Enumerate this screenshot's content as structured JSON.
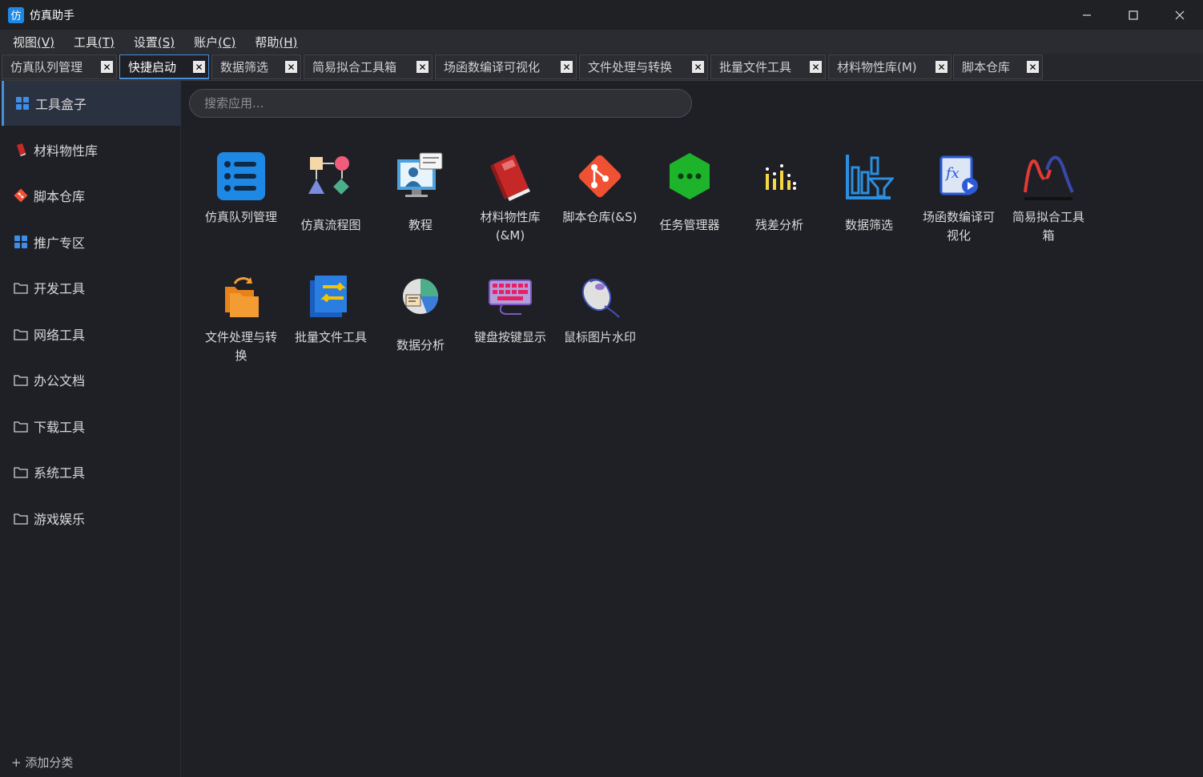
{
  "window": {
    "logo_char": "仿",
    "title": "仿真助手",
    "minimize": "─",
    "maximize": "☐",
    "close": "✕"
  },
  "menu": [
    {
      "label": "视图",
      "accel": "(V)"
    },
    {
      "label": "工具",
      "accel": "(T)"
    },
    {
      "label": "设置",
      "accel": "(S)"
    },
    {
      "label": "账户",
      "accel": "(C)"
    },
    {
      "label": "帮助",
      "accel": "(H)"
    }
  ],
  "tabs": [
    {
      "label": "仿真队列管理",
      "close": "✕",
      "active": false
    },
    {
      "label": "快捷启动",
      "close": "✕",
      "active": true
    },
    {
      "label": "数据筛选",
      "close": "✕",
      "active": false
    },
    {
      "label": "简易拟合工具箱",
      "close": "✕",
      "active": false
    },
    {
      "label": "场函数编译可视化",
      "close": "✕",
      "active": false
    },
    {
      "label": "文件处理与转换",
      "close": "✕",
      "active": false
    },
    {
      "label": "批量文件工具",
      "close": "✕",
      "active": false
    },
    {
      "label": "材料物性库(M)",
      "close": "✕",
      "active": false
    },
    {
      "label": "脚本仓库",
      "close": "✕",
      "active": false
    }
  ],
  "sidebar": {
    "items": [
      {
        "label": "工具盒子",
        "icon": "grid-icon",
        "active": true
      },
      {
        "label": "材料物性库",
        "icon": "book-icon",
        "active": false
      },
      {
        "label": "脚本仓库",
        "icon": "git-icon",
        "active": false
      },
      {
        "label": "推广专区",
        "icon": "grid-icon",
        "active": false
      },
      {
        "label": "开发工具",
        "icon": "folder-icon",
        "active": false
      },
      {
        "label": "网络工具",
        "icon": "folder-icon",
        "active": false
      },
      {
        "label": "办公文档",
        "icon": "folder-icon",
        "active": false
      },
      {
        "label": "下载工具",
        "icon": "folder-icon",
        "active": false
      },
      {
        "label": "系统工具",
        "icon": "folder-icon",
        "active": false
      },
      {
        "label": "游戏娱乐",
        "icon": "folder-icon",
        "active": false
      }
    ],
    "add_category": "+ 添加分类"
  },
  "search": {
    "placeholder": "搜索应用..."
  },
  "apps": [
    {
      "label": "仿真队列管理",
      "icon": "list-icon"
    },
    {
      "label": "仿真流程图",
      "icon": "flowchart-icon"
    },
    {
      "label": "教程",
      "icon": "tutorial-icon"
    },
    {
      "label": "材料物性库(&M)",
      "icon": "book-icon"
    },
    {
      "label": "脚本仓库(&S)",
      "icon": "git-icon"
    },
    {
      "label": "任务管理器",
      "icon": "task-manager-icon"
    },
    {
      "label": "残差分析",
      "icon": "residual-chart-icon"
    },
    {
      "label": "数据筛选",
      "icon": "data-filter-icon"
    },
    {
      "label": "场函数编译可视化",
      "icon": "field-function-icon"
    },
    {
      "label": "简易拟合工具箱",
      "icon": "curve-fit-icon"
    },
    {
      "label": "文件处理与转换",
      "icon": "file-convert-icon"
    },
    {
      "label": "批量文件工具",
      "icon": "batch-file-icon"
    },
    {
      "label": "数据分析",
      "icon": "data-analysis-icon"
    },
    {
      "label": "键盘按键显示",
      "icon": "keyboard-icon"
    },
    {
      "label": "鼠标图片水印",
      "icon": "mouse-icon"
    }
  ],
  "colors": {
    "background": "#1f2026",
    "accent": "#4a90d9",
    "menubar": "#2b2c31"
  }
}
